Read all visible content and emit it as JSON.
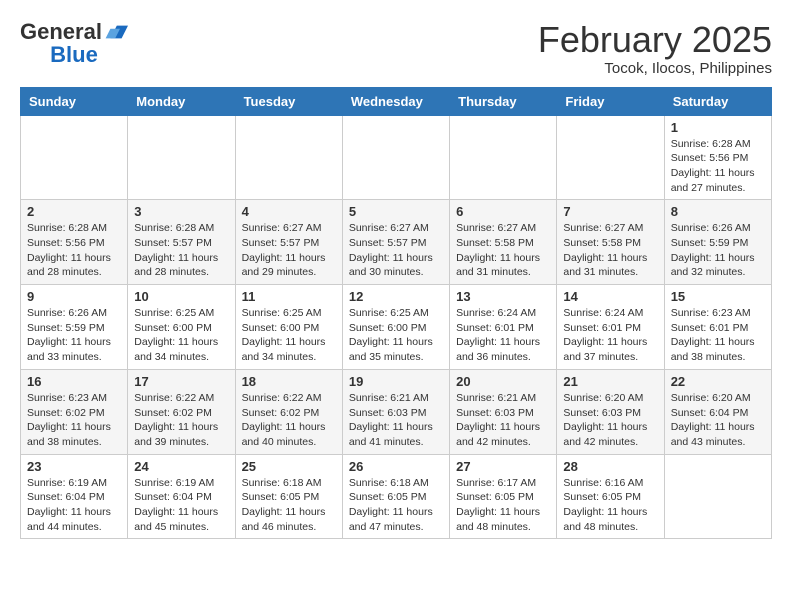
{
  "header": {
    "logo_general": "General",
    "logo_blue": "Blue",
    "month_year": "February 2025",
    "location": "Tocok, Ilocos, Philippines"
  },
  "weekdays": [
    "Sunday",
    "Monday",
    "Tuesday",
    "Wednesday",
    "Thursday",
    "Friday",
    "Saturday"
  ],
  "weeks": [
    [
      {
        "day": "",
        "info": ""
      },
      {
        "day": "",
        "info": ""
      },
      {
        "day": "",
        "info": ""
      },
      {
        "day": "",
        "info": ""
      },
      {
        "day": "",
        "info": ""
      },
      {
        "day": "",
        "info": ""
      },
      {
        "day": "1",
        "info": "Sunrise: 6:28 AM\nSunset: 5:56 PM\nDaylight: 11 hours and 27 minutes."
      }
    ],
    [
      {
        "day": "2",
        "info": "Sunrise: 6:28 AM\nSunset: 5:56 PM\nDaylight: 11 hours and 28 minutes."
      },
      {
        "day": "3",
        "info": "Sunrise: 6:28 AM\nSunset: 5:57 PM\nDaylight: 11 hours and 28 minutes."
      },
      {
        "day": "4",
        "info": "Sunrise: 6:27 AM\nSunset: 5:57 PM\nDaylight: 11 hours and 29 minutes."
      },
      {
        "day": "5",
        "info": "Sunrise: 6:27 AM\nSunset: 5:57 PM\nDaylight: 11 hours and 30 minutes."
      },
      {
        "day": "6",
        "info": "Sunrise: 6:27 AM\nSunset: 5:58 PM\nDaylight: 11 hours and 31 minutes."
      },
      {
        "day": "7",
        "info": "Sunrise: 6:27 AM\nSunset: 5:58 PM\nDaylight: 11 hours and 31 minutes."
      },
      {
        "day": "8",
        "info": "Sunrise: 6:26 AM\nSunset: 5:59 PM\nDaylight: 11 hours and 32 minutes."
      }
    ],
    [
      {
        "day": "9",
        "info": "Sunrise: 6:26 AM\nSunset: 5:59 PM\nDaylight: 11 hours and 33 minutes."
      },
      {
        "day": "10",
        "info": "Sunrise: 6:25 AM\nSunset: 6:00 PM\nDaylight: 11 hours and 34 minutes."
      },
      {
        "day": "11",
        "info": "Sunrise: 6:25 AM\nSunset: 6:00 PM\nDaylight: 11 hours and 34 minutes."
      },
      {
        "day": "12",
        "info": "Sunrise: 6:25 AM\nSunset: 6:00 PM\nDaylight: 11 hours and 35 minutes."
      },
      {
        "day": "13",
        "info": "Sunrise: 6:24 AM\nSunset: 6:01 PM\nDaylight: 11 hours and 36 minutes."
      },
      {
        "day": "14",
        "info": "Sunrise: 6:24 AM\nSunset: 6:01 PM\nDaylight: 11 hours and 37 minutes."
      },
      {
        "day": "15",
        "info": "Sunrise: 6:23 AM\nSunset: 6:01 PM\nDaylight: 11 hours and 38 minutes."
      }
    ],
    [
      {
        "day": "16",
        "info": "Sunrise: 6:23 AM\nSunset: 6:02 PM\nDaylight: 11 hours and 38 minutes."
      },
      {
        "day": "17",
        "info": "Sunrise: 6:22 AM\nSunset: 6:02 PM\nDaylight: 11 hours and 39 minutes."
      },
      {
        "day": "18",
        "info": "Sunrise: 6:22 AM\nSunset: 6:02 PM\nDaylight: 11 hours and 40 minutes."
      },
      {
        "day": "19",
        "info": "Sunrise: 6:21 AM\nSunset: 6:03 PM\nDaylight: 11 hours and 41 minutes."
      },
      {
        "day": "20",
        "info": "Sunrise: 6:21 AM\nSunset: 6:03 PM\nDaylight: 11 hours and 42 minutes."
      },
      {
        "day": "21",
        "info": "Sunrise: 6:20 AM\nSunset: 6:03 PM\nDaylight: 11 hours and 42 minutes."
      },
      {
        "day": "22",
        "info": "Sunrise: 6:20 AM\nSunset: 6:04 PM\nDaylight: 11 hours and 43 minutes."
      }
    ],
    [
      {
        "day": "23",
        "info": "Sunrise: 6:19 AM\nSunset: 6:04 PM\nDaylight: 11 hours and 44 minutes."
      },
      {
        "day": "24",
        "info": "Sunrise: 6:19 AM\nSunset: 6:04 PM\nDaylight: 11 hours and 45 minutes."
      },
      {
        "day": "25",
        "info": "Sunrise: 6:18 AM\nSunset: 6:05 PM\nDaylight: 11 hours and 46 minutes."
      },
      {
        "day": "26",
        "info": "Sunrise: 6:18 AM\nSunset: 6:05 PM\nDaylight: 11 hours and 47 minutes."
      },
      {
        "day": "27",
        "info": "Sunrise: 6:17 AM\nSunset: 6:05 PM\nDaylight: 11 hours and 48 minutes."
      },
      {
        "day": "28",
        "info": "Sunrise: 6:16 AM\nSunset: 6:05 PM\nDaylight: 11 hours and 48 minutes."
      },
      {
        "day": "",
        "info": ""
      }
    ]
  ]
}
